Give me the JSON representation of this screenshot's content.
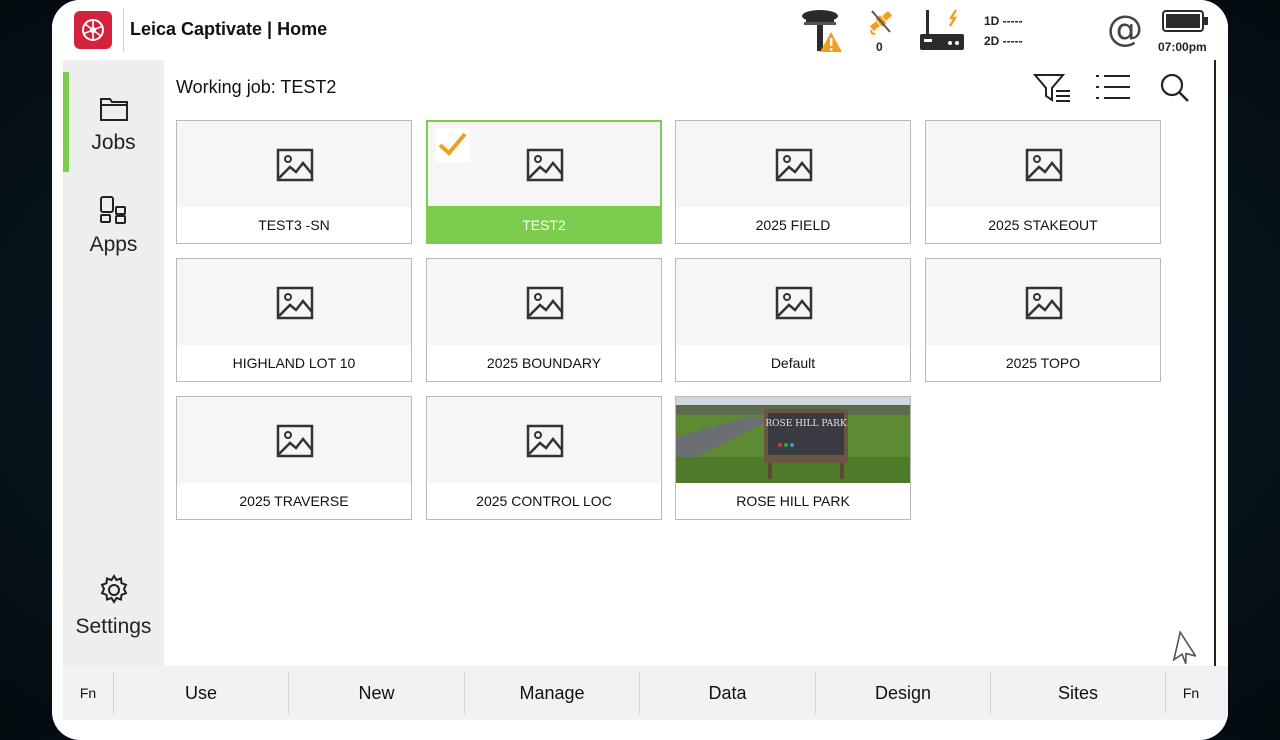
{
  "app": {
    "title": "Leica Captivate | Home"
  },
  "status": {
    "satellite_count": "0",
    "baseline_1d": "1D -----",
    "baseline_2d": "2D -----",
    "clock": "07:00pm",
    "icons": [
      "gnss-antenna-warning-icon",
      "satellite-icon",
      "radio-modem-icon",
      "internet-at-icon",
      "battery-icon"
    ],
    "warning_color": "#f0a020"
  },
  "nav": {
    "active": "jobs",
    "items": [
      {
        "id": "jobs",
        "label": "Jobs",
        "icon": "folder-icon"
      },
      {
        "id": "apps",
        "label": "Apps",
        "icon": "apps-icon"
      }
    ],
    "settings": {
      "label": "Settings",
      "icon": "gear-icon"
    }
  },
  "main": {
    "working_job": "Working job: TEST2",
    "toolbar": [
      "filter-icon",
      "list-view-icon",
      "search-icon"
    ],
    "jobs": [
      {
        "name": "TEST3 -SN",
        "selected": false,
        "photo": false
      },
      {
        "name": "TEST2",
        "selected": true,
        "photo": false
      },
      {
        "name": "2025 FIELD",
        "selected": false,
        "photo": false
      },
      {
        "name": "2025 STAKEOUT",
        "selected": false,
        "photo": false
      },
      {
        "name": "HIGHLAND LOT 10",
        "selected": false,
        "photo": false
      },
      {
        "name": "2025 BOUNDARY",
        "selected": false,
        "photo": false
      },
      {
        "name": "Default",
        "selected": false,
        "photo": false
      },
      {
        "name": "2025 TOPO",
        "selected": false,
        "photo": false
      },
      {
        "name": "2025 TRAVERSE",
        "selected": false,
        "photo": false
      },
      {
        "name": "2025 CONTROL LOC",
        "selected": false,
        "photo": false
      },
      {
        "name": "ROSE HILL PARK",
        "selected": false,
        "photo": true,
        "sign_text": "ROSE HILL PARK"
      }
    ]
  },
  "bottom_bar": {
    "fn_left": "Fn",
    "buttons": [
      "Use",
      "New",
      "Manage",
      "Data",
      "Design",
      "Sites"
    ],
    "fn_right": "Fn"
  },
  "colors": {
    "accent_green": "#7ccc4e",
    "brand_red": "#d4213d",
    "check_orange": "#f0a020"
  }
}
